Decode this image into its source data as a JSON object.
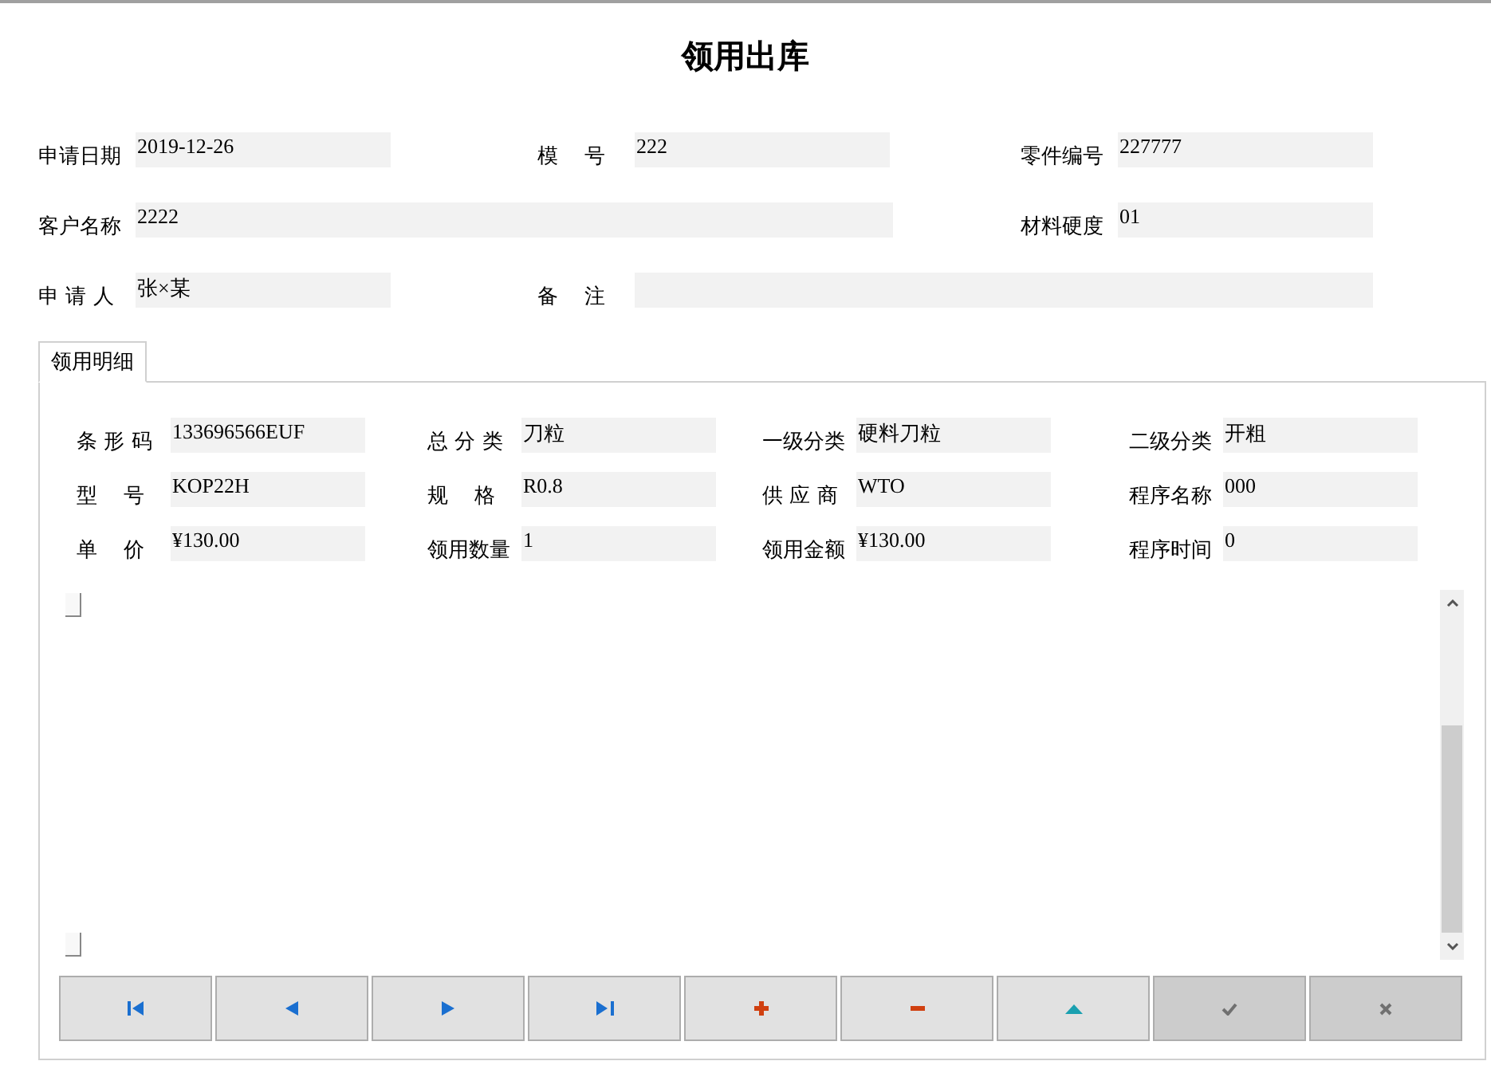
{
  "title": "领用出库",
  "header_fields": [
    {
      "label": "申请日期",
      "value": "2019-12-26"
    },
    {
      "label": "模    号",
      "value": "222"
    },
    {
      "label": "零件编号",
      "value": "227777"
    },
    {
      "label": "客户名称",
      "value": "2222"
    },
    {
      "label": "材料硬度",
      "value": "01"
    },
    {
      "label": "申 请 人",
      "value": "张×某"
    },
    {
      "label": "备    注"
    }
  ],
  "tabs": [
    {
      "label": "领用明细",
      "selected": true
    }
  ],
  "detail_fields": [
    {
      "label": "条 形 码",
      "value": "133696566EUF"
    },
    {
      "label": "总 分 类",
      "value": "刀粒"
    },
    {
      "label": "一级分类",
      "value": "硬料刀粒"
    },
    {
      "label": "二级分类",
      "value": "开粗"
    },
    {
      "label": "型    号",
      "value": "KOP22H"
    },
    {
      "label": "规    格",
      "value": "R0.8"
    },
    {
      "label": "供 应 商",
      "value": "WTO"
    },
    {
      "label": "程序名称",
      "value": "000"
    },
    {
      "label": "单    价",
      "value": "¥130.00"
    },
    {
      "label": "领用数量",
      "value": "1"
    },
    {
      "label": "领用金额",
      "value": "¥130.00"
    },
    {
      "label": "程序时间",
      "value": "0"
    }
  ],
  "navigator": [
    {
      "kind": "first",
      "disabled": false
    },
    {
      "kind": "prior",
      "disabled": false
    },
    {
      "kind": "next",
      "disabled": false
    },
    {
      "kind": "last",
      "disabled": false
    },
    {
      "kind": "insert",
      "disabled": false
    },
    {
      "kind": "delete",
      "disabled": false
    },
    {
      "kind": "edit",
      "disabled": false
    },
    {
      "kind": "post",
      "disabled": true
    },
    {
      "kind": "cancel",
      "disabled": true
    }
  ]
}
